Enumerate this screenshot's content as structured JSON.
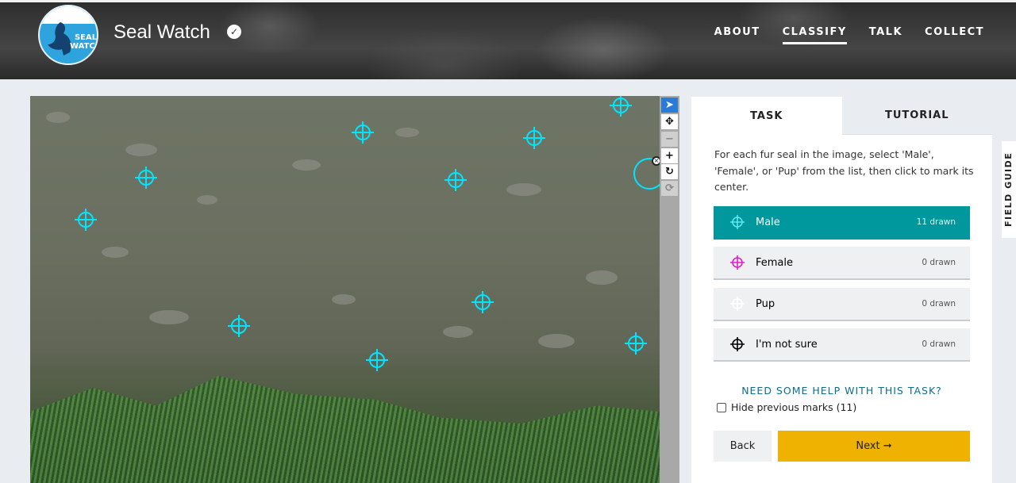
{
  "header": {
    "site_title": "Seal Watch",
    "logo_text_line1": "SEAL",
    "logo_text_line2": "WATCH",
    "nav": [
      {
        "label": "ABOUT",
        "active": false
      },
      {
        "label": "CLASSIFY",
        "active": true
      },
      {
        "label": "TALK",
        "active": false
      },
      {
        "label": "COLLECT",
        "active": false
      }
    ]
  },
  "icons": {
    "verified": "checkmark-badge-icon",
    "pointer": "arrow-pointer-icon",
    "move": "move-arrows-icon",
    "zoom_out": "minus-icon",
    "zoom_in": "plus-icon",
    "rotate": "rotate-icon",
    "reset": "reset-icon"
  },
  "marker_color": "#00e5ff",
  "task_panel": {
    "tabs": [
      {
        "label": "TASK",
        "active": true
      },
      {
        "label": "TUTORIAL",
        "active": false
      }
    ],
    "instructions": "For each fur seal in the image, select 'Male', 'Female', or 'Pup' from the list, then click to mark its center.",
    "choices": [
      {
        "label": "Male",
        "count": "11 drawn",
        "color": "#5ce8f0",
        "selected": true
      },
      {
        "label": "Female",
        "count": "0 drawn",
        "color": "#e020c8",
        "selected": false
      },
      {
        "label": "Pup",
        "count": "0 drawn",
        "color": "#ffffff",
        "selected": false
      },
      {
        "label": "I'm not sure",
        "count": "0 drawn",
        "color": "#000000",
        "selected": false
      }
    ],
    "help_link": "NEED SOME HELP WITH THIS TASK?",
    "hide_previous_label": "Hide previous marks (11)",
    "back_label": "Back",
    "next_label": "Next ➞"
  },
  "field_guide_label": "FIELD GUIDE",
  "colors": {
    "selected_choice": "#00979d",
    "next_button": "#f0b200",
    "help_link": "#0b6e8c"
  }
}
